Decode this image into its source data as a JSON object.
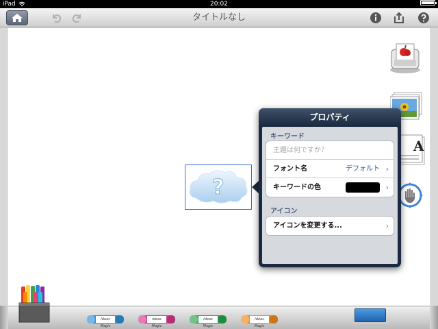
{
  "statusbar": {
    "device": "iPad",
    "time": "20:02"
  },
  "toolbar": {
    "title": "タイトルなし",
    "home_icon": "home-icon",
    "undo_icon": "undo-icon",
    "redo_icon": "redo-icon",
    "info_icon": "info-icon",
    "share_icon": "share-icon",
    "help_icon": "help-icon"
  },
  "node": {
    "placeholder_glyph": "?"
  },
  "popover": {
    "title": "プロパティ",
    "keyword_section": "キーワード",
    "topic_placeholder": "主題は何ですか？",
    "font_label": "フォント名",
    "font_value": "デフォルト",
    "keyword_color_label": "キーワードの色",
    "keyword_color": "#000000",
    "icon_section": "アイコン",
    "change_icon_label": "アイコンを変更する..."
  },
  "tray": {
    "markers": [
      {
        "color": "#2f8fd8",
        "brand": "Ideas Magic"
      },
      {
        "color": "#d23a8a",
        "brand": "Ideas Magic"
      },
      {
        "color": "#2aa447",
        "brand": "Ideas Magic"
      },
      {
        "color": "#ef8a1e",
        "brand": "Ideas Magic"
      }
    ]
  }
}
